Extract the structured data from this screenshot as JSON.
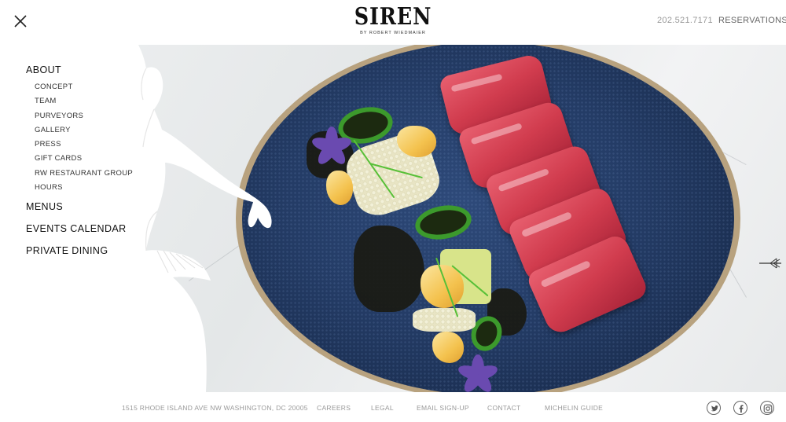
{
  "header": {
    "logo_main": "SIREN",
    "logo_sub": "BY ROBERT WIEDMAIER",
    "phone": "202.521.7171",
    "reservations_label": "RESERVATIONS",
    "close_icon": "close-icon"
  },
  "sidebar": {
    "about": {
      "label": "ABOUT",
      "items": [
        {
          "label": "CONCEPT"
        },
        {
          "label": "TEAM"
        },
        {
          "label": "PURVEYORS"
        },
        {
          "label": "GALLERY"
        },
        {
          "label": "PRESS"
        },
        {
          "label": "GIFT CARDS"
        },
        {
          "label": "RW RESTAURANT GROUP"
        },
        {
          "label": "HOURS"
        }
      ]
    },
    "menus": {
      "label": "MENUS"
    },
    "events": {
      "label": "EVENTS CALENDAR"
    },
    "private": {
      "label": "PRIVATE DINING"
    }
  },
  "hero": {
    "next_icon": "trident-arrow-icon",
    "mermaid_icon": "mermaid-silhouette-icon"
  },
  "footer": {
    "address": "1515 RHODE ISLAND AVE NW WASHINGTON, DC 20005",
    "careers": "CAREERS",
    "legal": "LEGAL",
    "email_signup": "EMAIL SIGN-UP",
    "contact": "CONTACT",
    "michelin": "MICHELIN GUIDE",
    "social": [
      "twitter-icon",
      "facebook-icon",
      "instagram-icon"
    ]
  },
  "colors": {
    "plate_blue": "#243c66",
    "tuna_red": "#d13c4e",
    "text_gray": "#999999"
  }
}
